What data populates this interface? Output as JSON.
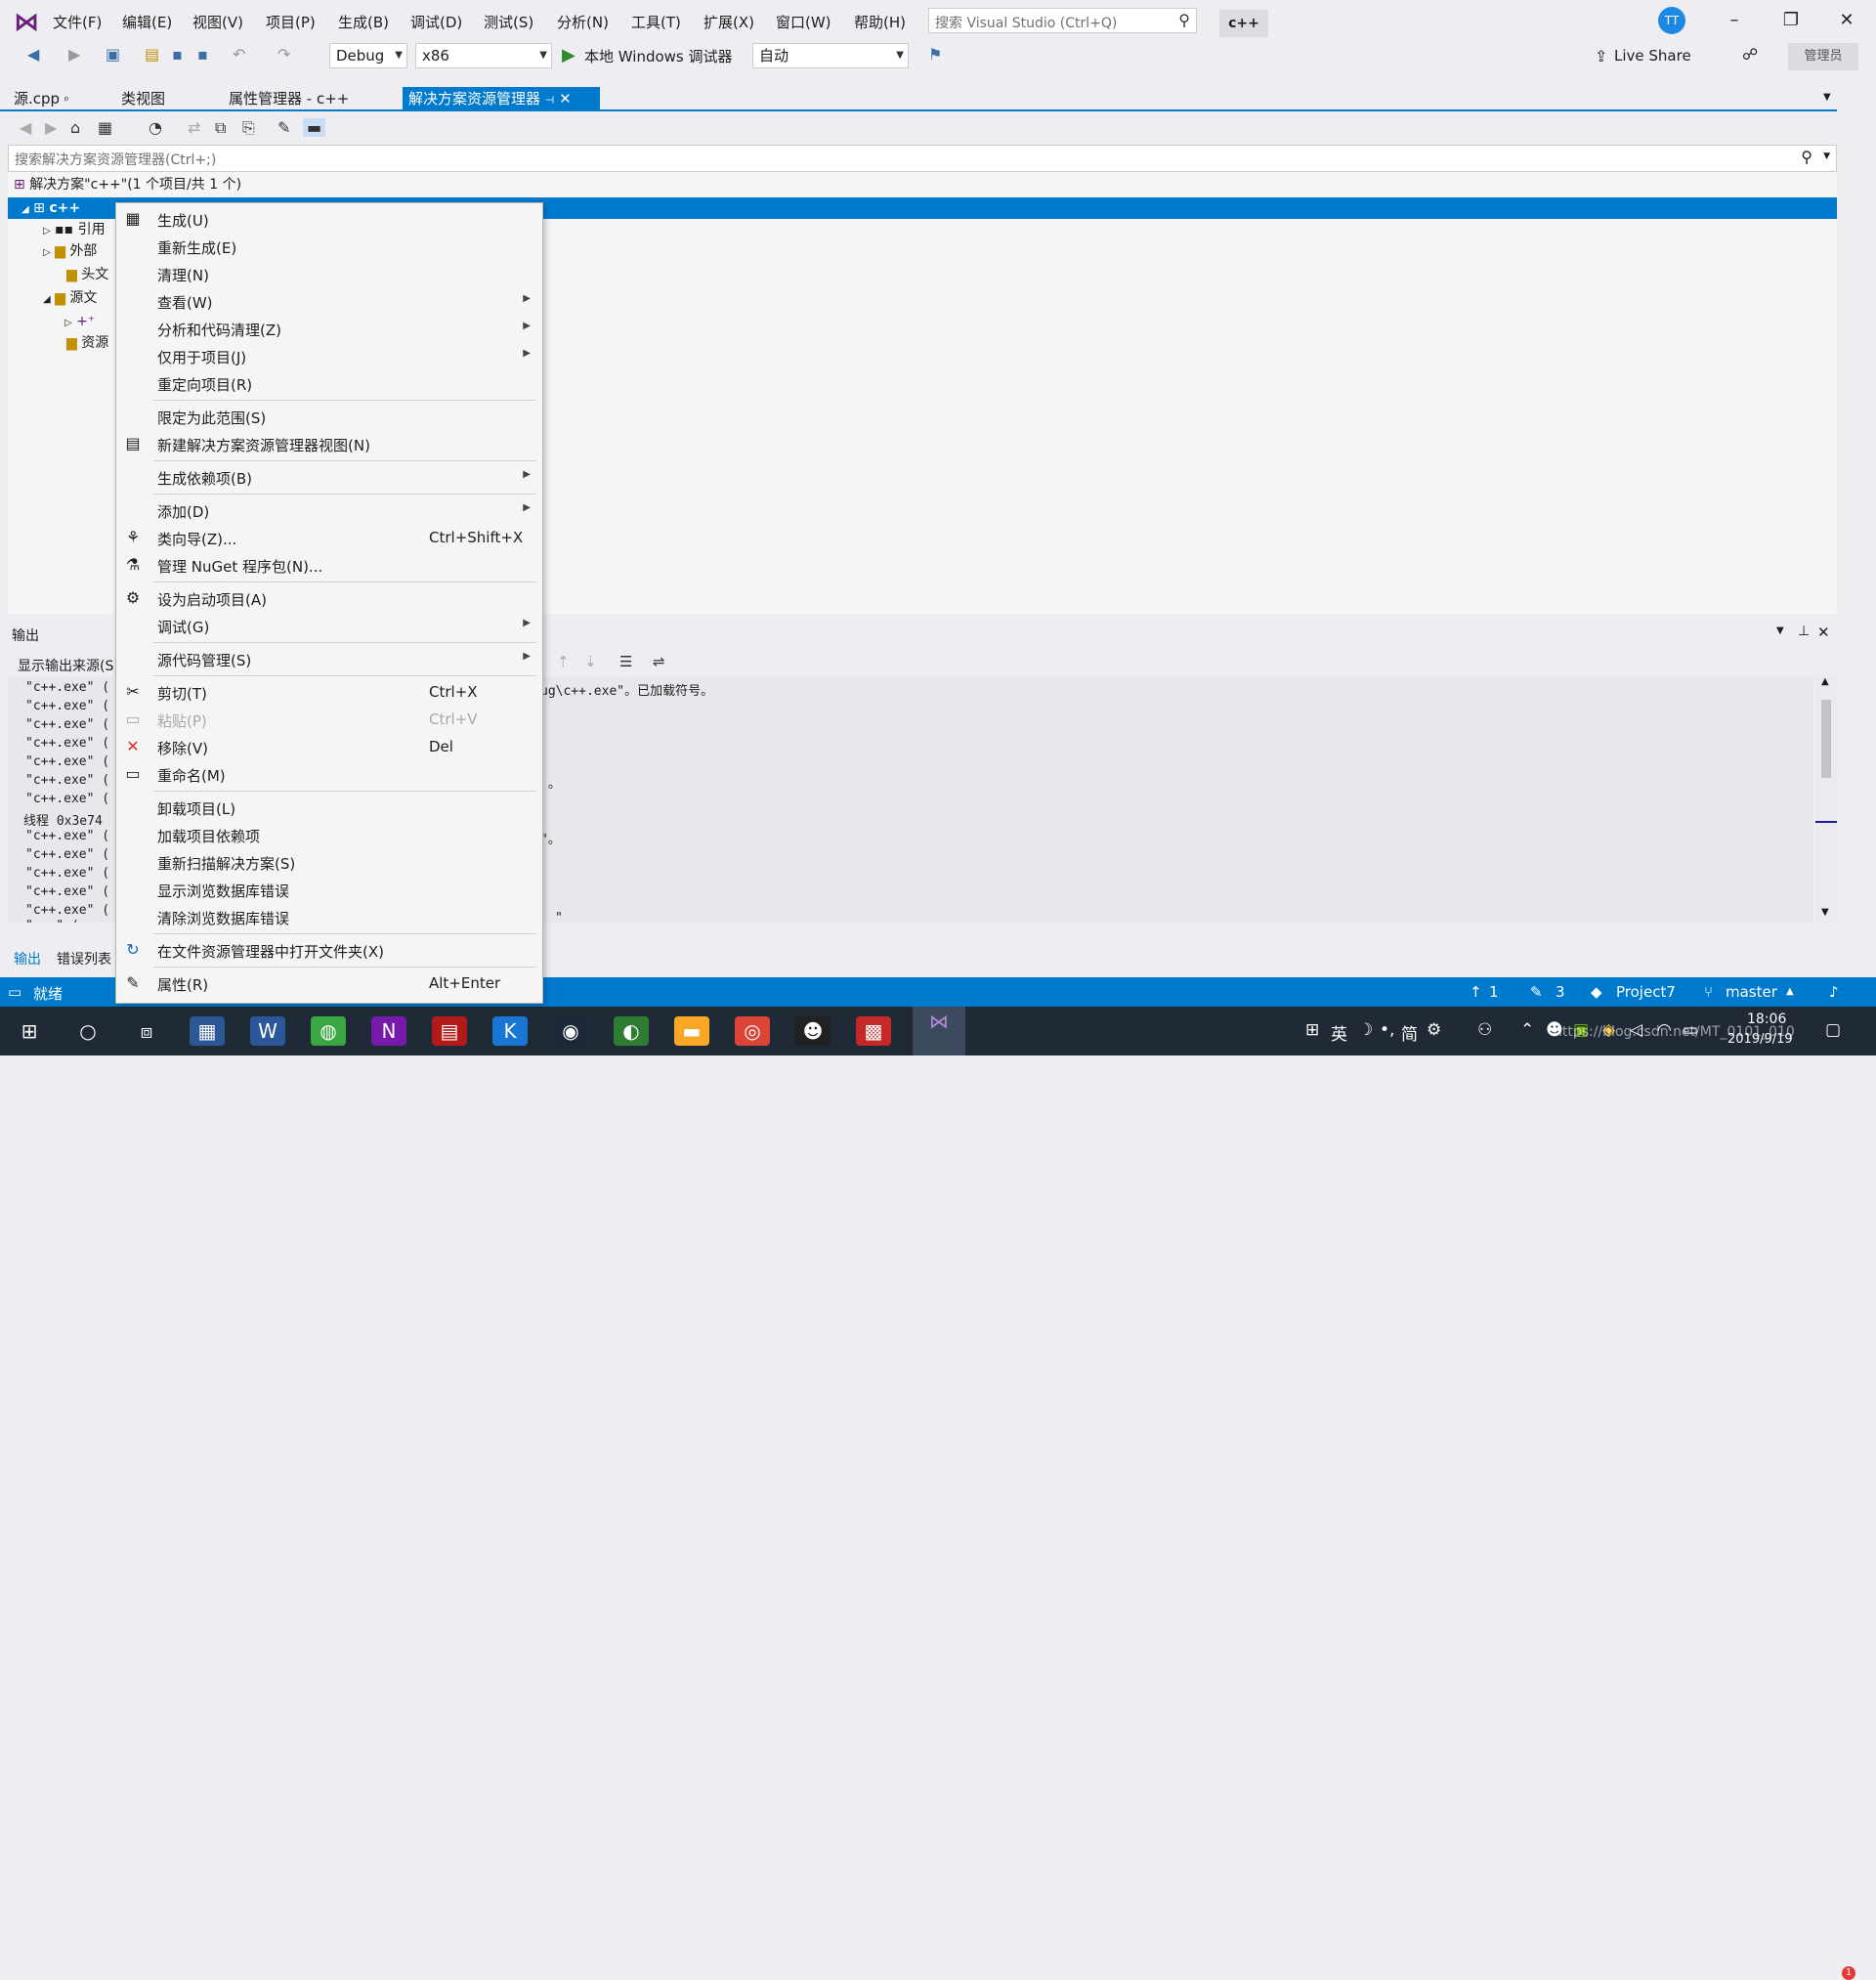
{
  "title_bar": {
    "menu": [
      "文件(F)",
      "编辑(E)",
      "视图(V)",
      "项目(P)",
      "生成(B)",
      "调试(D)",
      "测试(S)",
      "分析(N)",
      "工具(T)",
      "扩展(X)",
      "窗口(W)",
      "帮助(H)"
    ],
    "search_placeholder": "搜索 Visual Studio (Ctrl+Q)",
    "project_name": "c++",
    "avatar_initials": "TT"
  },
  "toolbar": {
    "configuration": "Debug",
    "platform": "x86",
    "debugger": "本地 Windows 调试器",
    "auto": "自动",
    "live_share": "Live Share",
    "admin": "管理员"
  },
  "tabs": [
    {
      "label": "源.cpp",
      "pin": "ᵖ"
    },
    {
      "label": "类视图"
    },
    {
      "label": "属性管理器 - c++"
    },
    {
      "label": "解决方案资源管理器",
      "active": true
    }
  ],
  "explorer": {
    "search_placeholder": "搜索解决方案资源管理器(Ctrl+;)",
    "solution_label": "解决方案\"c++\"(1 个项目/共 1 个)",
    "project_label": "c++",
    "nodes": [
      "引用",
      "外部",
      "头文",
      "源文",
      "",
      "资源"
    ]
  },
  "output": {
    "title": "输出",
    "source_label": "显示输出来源(S)",
    "lines": [
      "\"c++.exe\" (",
      "\"c++.exe\" (",
      "\"c++.exe\" (",
      "\"c++.exe\" (",
      "\"c++.exe\" (",
      "\"c++.exe\" (",
      "\"c++.exe\" (",
      "线程 0x3e74",
      "\"c++.exe\" (",
      "\"c++.exe\" (",
      "\"c++.exe\" (",
      "\"c++.exe\" (",
      "\"c++.exe\" (",
      "\"...\" ("
    ],
    "right_fragments": [
      "ug\\c++.exe\"。已加载符号。",
      "。",
      "\"。",
      "\""
    ],
    "tab_output": "输出",
    "tab_errors": "错误列表"
  },
  "context_menu": [
    {
      "label": "生成(U)",
      "icon": "build-icon"
    },
    {
      "label": "重新生成(E)"
    },
    {
      "label": "清理(N)"
    },
    {
      "label": "查看(W)",
      "submenu": true
    },
    {
      "label": "分析和代码清理(Z)",
      "submenu": true
    },
    {
      "label": "仅用于项目(J)",
      "submenu": true
    },
    {
      "label": "重定向项目(R)"
    },
    {
      "label": "限定为此范围(S)"
    },
    {
      "label": "新建解决方案资源管理器视图(N)",
      "icon": "new-view-icon"
    },
    {
      "label": "生成依赖项(B)",
      "submenu": true
    },
    {
      "label": "添加(D)",
      "submenu": true
    },
    {
      "label": "类向导(Z)...",
      "shortcut": "Ctrl+Shift+X",
      "icon": "class-wizard-icon"
    },
    {
      "label": "管理 NuGet 程序包(N)...",
      "icon": "nuget-icon"
    },
    {
      "label": "设为启动项目(A)",
      "icon": "gear-icon"
    },
    {
      "label": "调试(G)",
      "submenu": true
    },
    {
      "label": "源代码管理(S)",
      "submenu": true
    },
    {
      "label": "剪切(T)",
      "shortcut": "Ctrl+X",
      "icon": "cut-icon"
    },
    {
      "label": "粘贴(P)",
      "shortcut": "Ctrl+V",
      "icon": "paste-icon",
      "disabled": true
    },
    {
      "label": "移除(V)",
      "shortcut": "Del",
      "icon": "remove-icon"
    },
    {
      "label": "重命名(M)",
      "icon": "rename-icon"
    },
    {
      "label": "卸载项目(L)"
    },
    {
      "label": "加载项目依赖项"
    },
    {
      "label": "重新扫描解决方案(S)"
    },
    {
      "label": "显示浏览数据库错误"
    },
    {
      "label": "清除浏览数据库错误"
    },
    {
      "label": "在文件资源管理器中打开文件夹(X)",
      "icon": "open-folder-icon"
    },
    {
      "label": "属性(R)",
      "shortcut": "Alt+Enter",
      "icon": "wrench-icon"
    }
  ],
  "status_bar": {
    "status": "就绪",
    "up_count": "1",
    "edit_count": "3",
    "project": "Project7",
    "branch": "master",
    "notifications": "1"
  },
  "taskbar": {
    "ime": "英",
    "ime2": "简",
    "time": "18:06",
    "date": "2019/9/19",
    "watermark": "https://blog.csdn.net/MT_0101_010"
  },
  "colors": {
    "accent": "#007acc",
    "menu_bg": "#f5f5f5",
    "taskbar": "#1f2a36",
    "remove_red": "#d32f2f"
  }
}
